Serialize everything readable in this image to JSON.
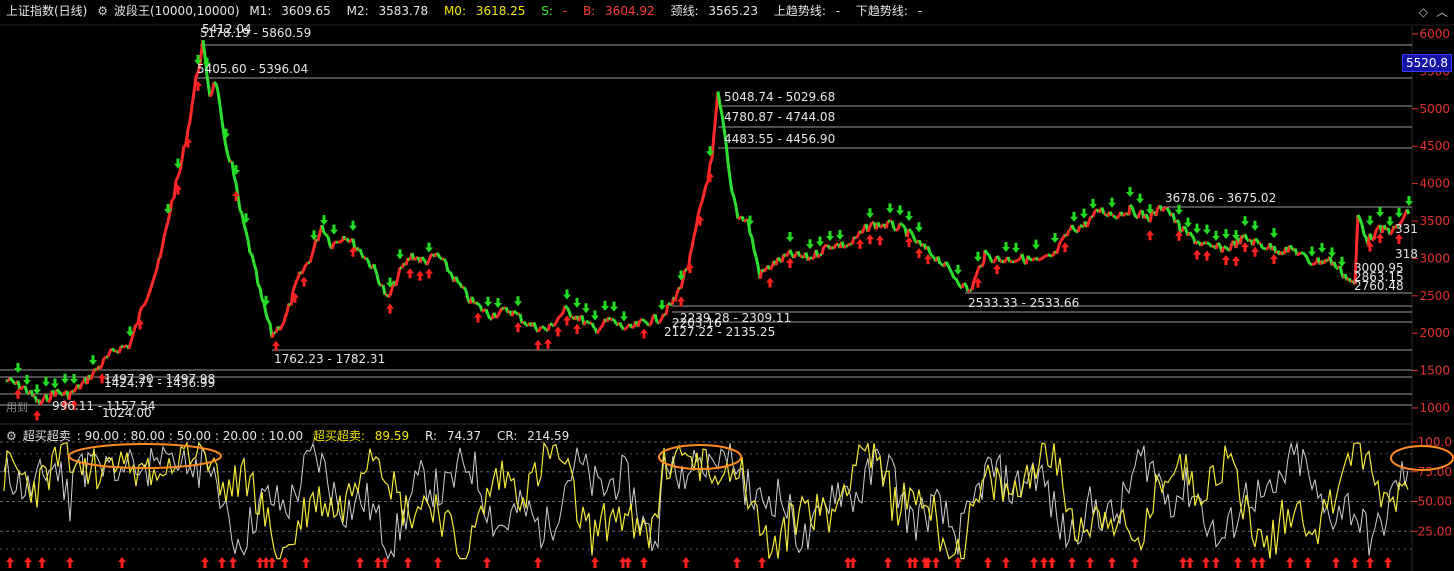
{
  "header": {
    "index_name": "上证指数(日线)",
    "indicator_name": "波段王(10000,10000)",
    "m1_label": "M1:",
    "m1_value": "3609.65",
    "m2_label": "M2:",
    "m2_value": "3583.78",
    "m0_label": "M0:",
    "m0_value": "3618.25",
    "s_label": "S:",
    "s_value": "-",
    "b_label": "B:",
    "b_value": "3604.92",
    "neck_label": "颈线:",
    "neck_value": "3565.23",
    "up_trend_label": "上趋势线:",
    "up_trend_value": "-",
    "down_trend_label": "下趋势线:",
    "down_trend_value": "-"
  },
  "top_right_icons": [
    "diamond-icon",
    "chevron-up-icon"
  ],
  "current_price_badge": "5520.8",
  "used_label": "用到",
  "price_axis": [
    "6000",
    "5500",
    "5000",
    "4500",
    "4000",
    "3500",
    "3000",
    "2500",
    "2000",
    "1500",
    "1000"
  ],
  "level_labels": [
    {
      "text": "5178.19 - 5860.59"
    },
    {
      "text": "5412.04"
    },
    {
      "text": "5405.60 - 5396.04"
    },
    {
      "text": "5048.74 - 5029.68"
    },
    {
      "text": "4780.87 - 4744.08"
    },
    {
      "text": "4483.55 - 4456.90"
    },
    {
      "text": "3678.06 - 3675.02"
    },
    {
      "text": "331"
    },
    {
      "text": "318"
    },
    {
      "text": "3000.95"
    },
    {
      "text": "2863.15"
    },
    {
      "text": "2760.48"
    },
    {
      "text": "2533.33 - 2533.66"
    },
    {
      "text": "2239.28 - 2309.11"
    },
    {
      "text": "2203.16"
    },
    {
      "text": "2127.22 - 2135.25"
    },
    {
      "text": "1762.23 - 1782.31"
    },
    {
      "text": "1497.20 - 1497.98"
    },
    {
      "text": "1424.71 - 1436.99"
    },
    {
      "text": "996.11 - 1157.54"
    },
    {
      "text": "1024.00"
    }
  ],
  "indicator": {
    "title": "超买超卖",
    "params": ": 90.00 : 80.00 : 50.00 : 20.00 : 10.00",
    "main_label": "超买超卖:",
    "main_value": "89.59",
    "r_label": "R:",
    "r_value": "74.37",
    "cr_label": "CR:",
    "cr_value": "214.59",
    "axis": [
      "100.0",
      "75.00",
      "50.00",
      "25.00"
    ]
  },
  "colors": {
    "background": "#000000",
    "price_up": "#ff2a2a",
    "price_down": "#30e030",
    "arrow_buy": "#ff2020",
    "arrow_sell": "#22dd22",
    "line_yellow": "#f2ea3a",
    "line_white": "#d0d0d0",
    "circle_orange": "#ff8a1e",
    "axis_red": "#e23030"
  }
}
